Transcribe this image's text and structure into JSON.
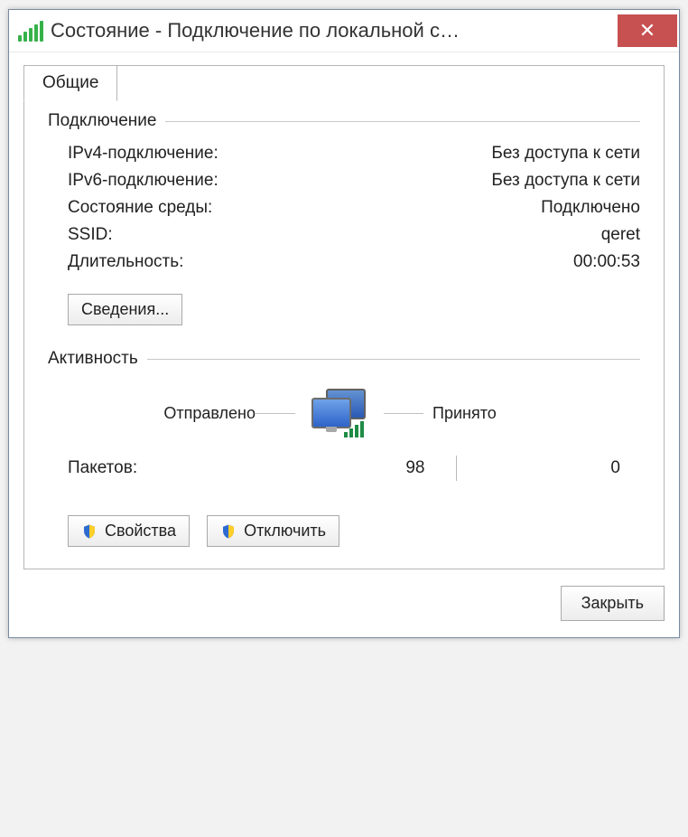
{
  "window": {
    "title": "Состояние - Подключение по локальной с…",
    "close_glyph": "✕"
  },
  "tab": {
    "label": "Общие"
  },
  "connection": {
    "heading": "Подключение",
    "rows": {
      "ipv4_label": "IPv4-подключение:",
      "ipv4_value": "Без доступа к сети",
      "ipv6_label": "IPv6-подключение:",
      "ipv6_value": "Без доступа к сети",
      "media_label": "Состояние среды:",
      "media_value": "Подключено",
      "ssid_label": "SSID:",
      "ssid_value": "qeret",
      "dur_label": "Длительность:",
      "dur_value": "00:00:53"
    },
    "details_button": "Сведения..."
  },
  "activity": {
    "heading": "Активность",
    "sent_label": "Отправлено",
    "recv_label": "Принято",
    "packets_label": "Пакетов:",
    "packets_sent": "98",
    "packets_recv": "0"
  },
  "buttons": {
    "properties": "Свойства",
    "disable": "Отключить",
    "close": "Закрыть"
  }
}
